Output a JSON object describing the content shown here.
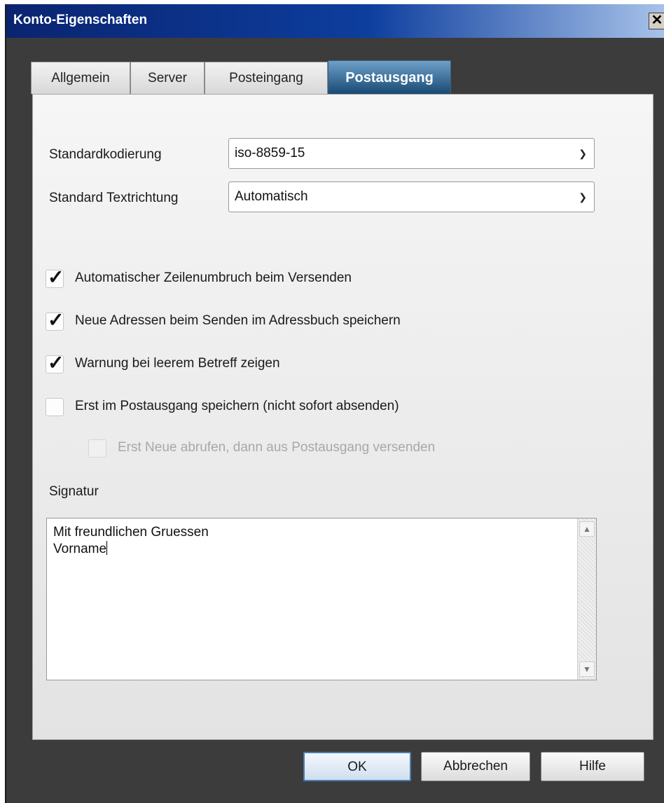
{
  "window": {
    "title": "Konto-Eigenschaften",
    "close_glyph": "✕"
  },
  "tabs": [
    {
      "label": "Allgemein",
      "active": false
    },
    {
      "label": "Server",
      "active": false
    },
    {
      "label": "Posteingang",
      "active": false
    },
    {
      "label": "Postausgang",
      "active": true
    }
  ],
  "fields": {
    "encoding": {
      "label": "Standardkodierung",
      "value": "iso-8859-15"
    },
    "direction": {
      "label": "Standard Textrichtung",
      "value": "Automatisch"
    }
  },
  "checkboxes": [
    {
      "label": "Automatischer Zeilenumbruch beim Versenden",
      "checked": true,
      "enabled": true
    },
    {
      "label": "Neue Adressen beim Senden im Adressbuch speichern",
      "checked": true,
      "enabled": true
    },
    {
      "label": "Warnung bei leerem Betreff zeigen",
      "checked": true,
      "enabled": true
    },
    {
      "label": "Erst im Postausgang speichern (nicht sofort absenden)",
      "checked": false,
      "enabled": true
    },
    {
      "label": "Erst Neue abrufen, dann aus Postausgang versenden",
      "checked": false,
      "enabled": false
    }
  ],
  "signature": {
    "label": "Signatur",
    "line1": "Mit freundlichen Gruessen",
    "line2": "Vorname"
  },
  "buttons": {
    "ok": "OK",
    "cancel": "Abbrechen",
    "help": "Hilfe"
  },
  "icons": {
    "chevron": "chevron-down-icon",
    "check": "check-icon",
    "close": "close-icon",
    "scroll_up": "scroll-up-icon",
    "scroll_down": "scroll-down-icon"
  },
  "colors": {
    "title_gradient_start": "#0a2470",
    "active_tab": "#184a74",
    "frame": "#3c3c3c",
    "default_button_border": "#4a7eb0"
  }
}
